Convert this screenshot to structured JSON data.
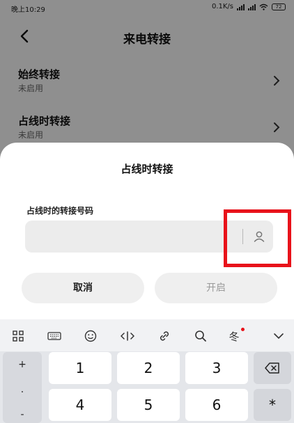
{
  "status_bar": {
    "time": "晚上10:29",
    "network_speed": "0.1K/s",
    "battery": "72"
  },
  "nav": {
    "title": "来电转接"
  },
  "settings": [
    {
      "title": "始终转接",
      "subtitle": "未启用"
    },
    {
      "title": "占线时转接",
      "subtitle": "未启用"
    }
  ],
  "dialog": {
    "title": "占线时转接",
    "field_label": "占线时的转接号码",
    "input_value": "",
    "cancel_label": "取消",
    "confirm_label": "开启"
  },
  "keyboard": {
    "toolbar_icons": [
      "grid-icon",
      "keyboard-icon",
      "emoji-icon",
      "cursor-icon",
      "link-icon",
      "search-icon",
      "handwriting-icon",
      "collapse-icon"
    ],
    "handwriting_glyph": "冬",
    "side_keys": [
      "+",
      ".",
      "-"
    ],
    "row1": [
      "1",
      "2",
      "3"
    ],
    "row2": [
      "4",
      "5",
      "6"
    ],
    "asterisk": "*"
  },
  "colors": {
    "highlight": "#e8121a",
    "accent_dot": "#e8121a"
  }
}
